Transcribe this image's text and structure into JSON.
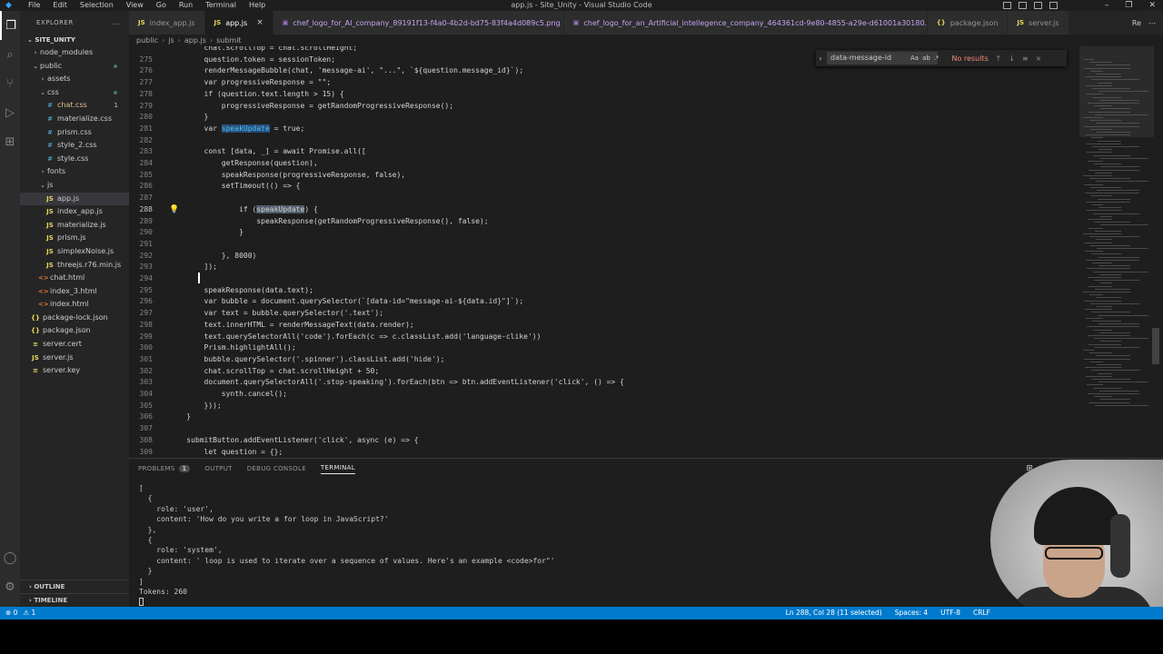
{
  "titlebar": {
    "title": "app.js - Site_Unity - Visual Studio Code",
    "menu": [
      "File",
      "Edit",
      "Selection",
      "View",
      "Go",
      "Run",
      "Terminal",
      "Help"
    ]
  },
  "sidebar": {
    "header": "EXPLORER",
    "more": "...",
    "root": "SITE_UNITY",
    "items": [
      {
        "label": "node_modules",
        "type": "folder",
        "chev": "›",
        "indent": 1
      },
      {
        "label": "public",
        "type": "folder-open",
        "chev": "⌄",
        "indent": 1,
        "git": "dot"
      },
      {
        "label": "assets",
        "type": "folder",
        "chev": "›",
        "indent": 2
      },
      {
        "label": "css",
        "type": "folder-open",
        "chev": "⌄",
        "indent": 2,
        "git": "dot"
      },
      {
        "label": "chat.css",
        "type": "css",
        "icon": "#",
        "indent": 3,
        "badge": "1",
        "warn": true
      },
      {
        "label": "materialize.css",
        "type": "css",
        "icon": "#",
        "indent": 3
      },
      {
        "label": "prism.css",
        "type": "css",
        "icon": "#",
        "indent": 3
      },
      {
        "label": "style_2.css",
        "type": "css",
        "icon": "#",
        "indent": 3
      },
      {
        "label": "style.css",
        "type": "css",
        "icon": "#",
        "indent": 3
      },
      {
        "label": "fonts",
        "type": "folder",
        "chev": "›",
        "indent": 2
      },
      {
        "label": "js",
        "type": "folder-open",
        "chev": "⌄",
        "indent": 2
      },
      {
        "label": "app.js",
        "type": "js",
        "icon": "JS",
        "indent": 3,
        "selected": true
      },
      {
        "label": "index_app.js",
        "type": "js",
        "icon": "JS",
        "indent": 3
      },
      {
        "label": "materialize.js",
        "type": "js",
        "icon": "JS",
        "indent": 3
      },
      {
        "label": "prism.js",
        "type": "js",
        "icon": "JS",
        "indent": 3
      },
      {
        "label": "simplexNoise.js",
        "type": "js",
        "icon": "JS",
        "indent": 3
      },
      {
        "label": "threejs.r76.min.js",
        "type": "js",
        "icon": "JS",
        "indent": 3
      },
      {
        "label": "chat.html",
        "type": "html",
        "icon": "<>",
        "indent": 2
      },
      {
        "label": "index_3.html",
        "type": "html",
        "icon": "<>",
        "indent": 2
      },
      {
        "label": "index.html",
        "type": "html",
        "icon": "<>",
        "indent": 2
      },
      {
        "label": "package-lock.json",
        "type": "json",
        "icon": "{}",
        "indent": 1
      },
      {
        "label": "package.json",
        "type": "json",
        "icon": "{}",
        "indent": 1
      },
      {
        "label": "server.cert",
        "type": "key",
        "icon": "≡",
        "indent": 1
      },
      {
        "label": "server.js",
        "type": "js",
        "icon": "JS",
        "indent": 1
      },
      {
        "label": "server.key",
        "type": "key",
        "icon": "≡",
        "indent": 1
      }
    ],
    "sections": [
      "OUTLINE",
      "TIMELINE"
    ]
  },
  "tabs": [
    {
      "label": "index_app.js",
      "icon": "JS",
      "kind": "js",
      "active": false
    },
    {
      "label": "app.js",
      "icon": "JS",
      "kind": "js",
      "active": true,
      "close": "×"
    },
    {
      "label": "chef_logo_for_AI_company_89191f13-f4a0-4b2d-bd75-83f4a4d089c5.png",
      "icon": "▣",
      "kind": "img",
      "active": false
    },
    {
      "label": "chef_logo_for_an_Artificial_intellegence_company_464361cd-9e80-4855-a29e-d61001a30180.png",
      "icon": "▣",
      "kind": "img",
      "active": false
    },
    {
      "label": "package.json",
      "icon": "{}",
      "kind": "json",
      "active": false
    },
    {
      "label": "server.js",
      "icon": "JS",
      "kind": "js",
      "active": false
    }
  ],
  "tab_actions": [
    "Re",
    "⋯"
  ],
  "breadcrumb": [
    "public",
    "js",
    "app.js",
    "submit"
  ],
  "find": {
    "value": "data-message-id",
    "options": [
      "Aa",
      "ab",
      ".*"
    ],
    "result": "No results",
    "nav": [
      "↑",
      "↓",
      "≡",
      "×"
    ]
  },
  "code": [
    {
      "n": "",
      "text": "        chat.scrollTop = chat.scrollHeight;",
      "indent": 0
    },
    {
      "n": "275",
      "text": "        question.token = sessionToken;"
    },
    {
      "n": "276",
      "text": "        renderMessageBubble(chat, 'message-ai', \"...\", `${question.message_id}`);"
    },
    {
      "n": "277",
      "text": "        var progressiveResponse = \"\";"
    },
    {
      "n": "278",
      "text": "        if (question.text.length > 15) {"
    },
    {
      "n": "279",
      "text": "            progressiveResponse = getRandomProgressiveResponse();"
    },
    {
      "n": "280",
      "text": "        }"
    },
    {
      "n": "281",
      "text": "        var speakUpdate = true;",
      "hl": "speakUpdate"
    },
    {
      "n": "282",
      "text": ""
    },
    {
      "n": "283",
      "text": "        const [data, _] = await Promise.all(["
    },
    {
      "n": "284",
      "text": "            getResponse(question),"
    },
    {
      "n": "285",
      "text": "            speakResponse(progressiveResponse, false),"
    },
    {
      "n": "286",
      "text": "            setTimeout(() => {"
    },
    {
      "n": "287",
      "text": ""
    },
    {
      "n": "288",
      "text": "                if (speakUpdate) {",
      "hl": "speakUpdate",
      "current": true
    },
    {
      "n": "289",
      "text": "                    speakResponse(getRandomProgressiveResponse(), false);"
    },
    {
      "n": "290",
      "text": "                }"
    },
    {
      "n": "291",
      "text": ""
    },
    {
      "n": "292",
      "text": "            }, 8000)"
    },
    {
      "n": "293",
      "text": "        ]);"
    },
    {
      "n": "294",
      "text": ""
    },
    {
      "n": "295",
      "text": "        speakResponse(data.text);"
    },
    {
      "n": "296",
      "text": "        var bubble = document.querySelector(`[data-id=\"message-ai-${data.id}\"]`);"
    },
    {
      "n": "297",
      "text": "        var text = bubble.querySelector('.text');"
    },
    {
      "n": "298",
      "text": "        text.innerHTML = renderMessageText(data.render);"
    },
    {
      "n": "299",
      "text": "        text.querySelectorAll('code').forEach(c => c.classList.add('language-clike'))"
    },
    {
      "n": "300",
      "text": "        Prism.highlightAll();"
    },
    {
      "n": "301",
      "text": "        bubble.querySelector('.spinner').classList.add('hide');"
    },
    {
      "n": "302",
      "text": "        chat.scrollTop = chat.scrollHeight + 50;"
    },
    {
      "n": "303",
      "text": "        document.querySelectorAll('.stop-speaking').forEach(btn => btn.addEventListener('click', () => {"
    },
    {
      "n": "304",
      "text": "            synth.cancel();"
    },
    {
      "n": "305",
      "text": "        }));"
    },
    {
      "n": "306",
      "text": "    }"
    },
    {
      "n": "307",
      "text": ""
    },
    {
      "n": "308",
      "text": "    submitButton.addEventListener('click', async (e) => {"
    },
    {
      "n": "309",
      "text": "        let question = {};"
    }
  ],
  "panel": {
    "tabs": [
      {
        "label": "PROBLEMS",
        "count": "1"
      },
      {
        "label": "OUTPUT"
      },
      {
        "label": "DEBUG CONSOLE"
      },
      {
        "label": "TERMINAL",
        "active": true
      }
    ],
    "actions": [
      "⊞",
      "+",
      "⌄",
      "▥",
      "🗑",
      "⋯",
      "^",
      "×"
    ],
    "terminal": [
      "[",
      "  {",
      "    role: 'user',",
      "    content: 'How do you write a for loop in JavaScript?'",
      "  },",
      "  {",
      "    role: 'system',",
      "    content: ' loop is used to iterate over a sequence of values. Here's an example <code>for\"'",
      "  }",
      "]",
      "Tokens: 260"
    ]
  },
  "statusbar": {
    "left": [
      "⊗ 0",
      "⚠ 1"
    ],
    "right": [
      "Ln 288, Col 28 (11 selected)",
      "Spaces: 4",
      "UTF-8",
      "CRLF"
    ]
  }
}
